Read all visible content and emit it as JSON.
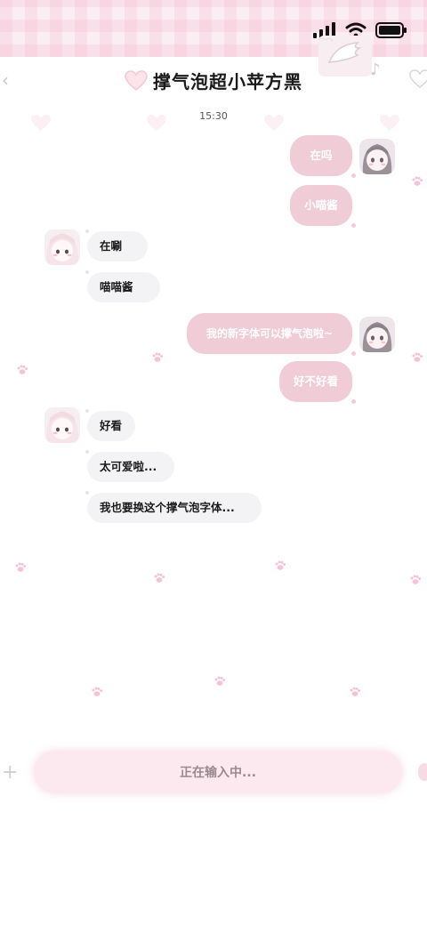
{
  "status_bar": {
    "signal_icon": "signal-bars-icon",
    "wifi_icon": "wifi-icon",
    "battery_icon": "battery-icon"
  },
  "header": {
    "title": "撑气泡超小苹方黑",
    "back_icon": "chevron-left-icon",
    "heart_icon": "heart-icon"
  },
  "chat": {
    "timestamp": "15:30",
    "messages": [
      {
        "side": "out",
        "text": "在吗"
      },
      {
        "side": "out",
        "text": "小喵酱"
      },
      {
        "side": "in",
        "text": "在唰"
      },
      {
        "side": "in",
        "text": "喵喵酱"
      },
      {
        "side": "out",
        "text": "我的新字体可以撑气泡啦~"
      },
      {
        "side": "out",
        "text": "好不好看"
      },
      {
        "side": "in",
        "text": "好看"
      },
      {
        "side": "in",
        "text": "太可爱啦..."
      },
      {
        "side": "in",
        "text": "我也要换这个撑气泡字体..."
      }
    ]
  },
  "input": {
    "placeholder": "正在输入中..."
  },
  "colors": {
    "outgoing_bubble": "#f0ccd7",
    "incoming_bubble": "#f3f3f5",
    "accent_pink": "#f4c4d6"
  }
}
